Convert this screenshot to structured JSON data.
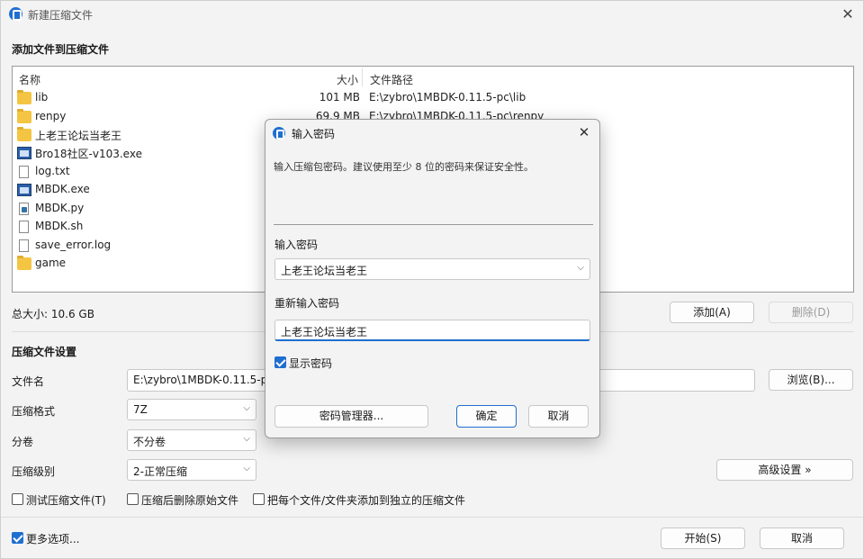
{
  "window": {
    "title": "新建压缩文件",
    "close_label": "✕"
  },
  "add_section": {
    "heading": "添加文件到压缩文件"
  },
  "file_list": {
    "columns": {
      "name": "名称",
      "size": "大小",
      "path": "文件路径"
    },
    "rows": [
      {
        "icon": "folder-icon",
        "name": "lib",
        "size": "101 MB",
        "path": "E:\\zybro\\1MBDK-0.11.5-pc\\lib"
      },
      {
        "icon": "folder-icon",
        "name": "renpy",
        "size": "69.9 MB",
        "path": "E:\\zybro\\1MBDK-0.11.5-pc\\renpy"
      },
      {
        "icon": "folder-icon",
        "name": "上老王论坛当老王",
        "size": "",
        "path": ""
      },
      {
        "icon": "exe-icon",
        "name": "Bro18社区-v103.exe",
        "size": "",
        "path": ""
      },
      {
        "icon": "file-icon",
        "name": "log.txt",
        "size": "",
        "path": ""
      },
      {
        "icon": "exe-icon",
        "name": "MBDK.exe",
        "size": "",
        "path": ""
      },
      {
        "icon": "python-file-icon",
        "name": "MBDK.py",
        "size": "",
        "path": ""
      },
      {
        "icon": "file-icon",
        "name": "MBDK.sh",
        "size": "",
        "path": ""
      },
      {
        "icon": "file-icon",
        "name": "save_error.log",
        "size": "",
        "path": ""
      },
      {
        "icon": "folder-icon",
        "name": "game",
        "size": "",
        "path": ""
      }
    ]
  },
  "total_size": "总大小: 10.6 GB",
  "buttons": {
    "add": "添加(A)",
    "remove": "删除(D)",
    "browse": "浏览(B)...",
    "advanced": "高级设置 »",
    "start": "开始(S)",
    "cancel": "取消"
  },
  "settings": {
    "heading": "压缩文件设置",
    "filename_label": "文件名",
    "filename_value": "E:\\zybro\\1MBDK-0.11.5-pc",
    "format_label": "压缩格式",
    "format_value": "7Z",
    "split_label": "分卷",
    "split_value": "不分卷",
    "level_label": "压缩级别",
    "level_value": "2-正常压缩"
  },
  "options": {
    "test": "测试压缩文件(T)",
    "delete_source": "压缩后删除原始文件",
    "separate": "把每个文件/文件夹添加到独立的压缩文件",
    "more": "更多选项..."
  },
  "dialog": {
    "title": "输入密码",
    "close_label": "✕",
    "description": "输入压缩包密码。建议使用至少 8 位的密码来保证安全性。",
    "password_label": "输入密码",
    "password_value": "上老王论坛当老王",
    "confirm_label": "重新输入密码",
    "confirm_value": "上老王论坛当老王",
    "show_password": "显示密码",
    "manager_button": "密码管理器...",
    "ok_button": "确定",
    "cancel_button": "取消"
  },
  "colors": {
    "accent": "#1f6fd0",
    "folder": "#f4c542"
  }
}
